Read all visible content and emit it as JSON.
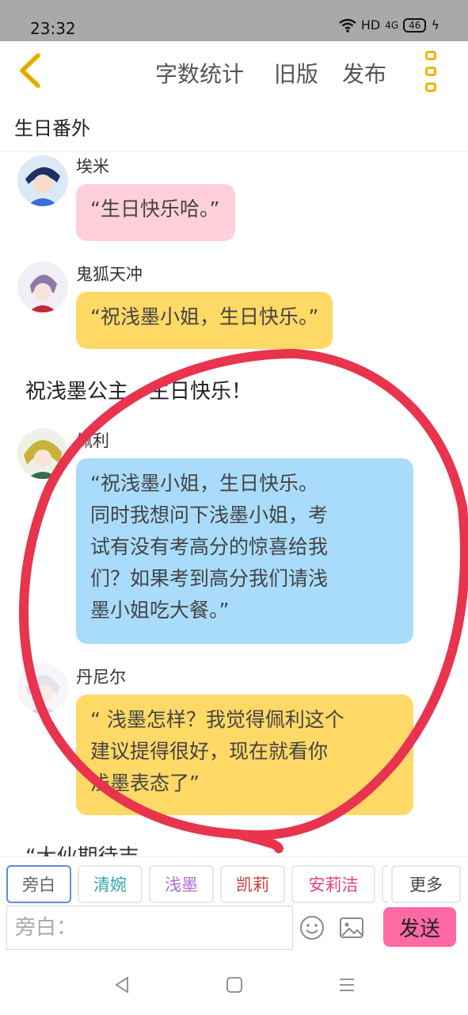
{
  "status": {
    "time": "23:32",
    "network": "HD",
    "signal": "4G",
    "battery": "46"
  },
  "toolbar": {
    "stats_label": "字数统计",
    "old_label": "旧版",
    "publish_label": "发布"
  },
  "chapter": {
    "title": "生日番外"
  },
  "messages": [
    {
      "name": "埃米",
      "text": "“生日快乐哈。”",
      "bubble_color": "#ffd0dc"
    },
    {
      "name": "鬼狐天冲",
      "text": "“祝浅墨小姐，生日快乐。”",
      "bubble_color": "#ffd966"
    },
    {
      "narration": "祝浅墨公主，生日快乐！"
    },
    {
      "name": "佩利",
      "lines": [
        "“祝浅墨小姐，生日快乐。",
        "同时我想问下浅墨小姐，考",
        "试有没有考高分的惊喜给我",
        "们？如果考到高分我们请浅",
        "墨小姐吃大餐。”"
      ],
      "bubble_color": "#a9dcfb"
    },
    {
      "name": "丹尼尔",
      "lines": [
        "“ 浅墨怎样？我觉得佩利这个",
        "建议提得很好，现在就看你",
        "浅墨表态了”"
      ],
      "bubble_color": "#ffd966"
    }
  ],
  "annotation_color": "#e8344e",
  "characters": [
    {
      "label": "旁白",
      "color": "#666666"
    },
    {
      "label": "清婉",
      "color": "#2fa8a8"
    },
    {
      "label": "浅墨",
      "color": "#b070d8"
    },
    {
      "label": "凯莉",
      "color": "#d03a3a"
    },
    {
      "label": "安莉洁",
      "color": "#e0408a"
    },
    {
      "label": "更多",
      "color": "#444444"
    }
  ],
  "composer": {
    "placeholder": "旁白：",
    "send_label": "发送"
  }
}
